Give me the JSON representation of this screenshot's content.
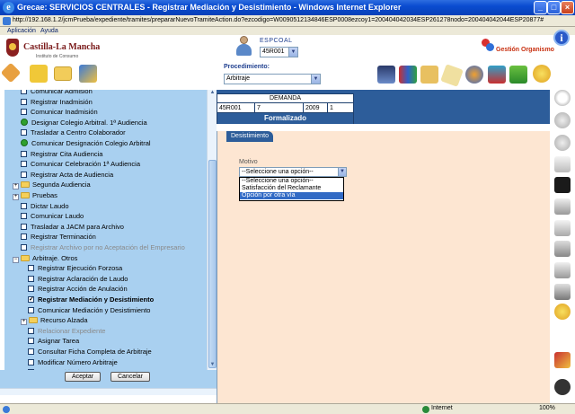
{
  "window": {
    "title": "Grecae: SERVICIOS CENTRALES - Registrar Mediación y Desistimiento - Windows Internet Explorer",
    "url": "http://192.168.1.2/jcmPrueba/expediente/tramites/prepararNuevoTramiteAction.do?ezcodigo=W0090512134846ESP0008ezcoy1=200404042034ESP261278nodo=200404042044ESP20877#",
    "menu": [
      "Aplicación",
      "Ayuda"
    ]
  },
  "header": {
    "logo_name": "Castilla-La Mancha",
    "logo_sub": "Instituto de Consumo",
    "user_name": "ESPCOAL",
    "user_code": "45R001",
    "management_label": "Gestión Organismo",
    "procedure_label": "Procedimiento:",
    "procedure_value": "Arbitraje"
  },
  "tree": {
    "items": [
      {
        "label": "Comunicar Admisión",
        "kind": "checkbox"
      },
      {
        "label": "Registrar Inadmisión",
        "kind": "checkbox"
      },
      {
        "label": "Comunicar Inadmisión",
        "kind": "checkbox"
      },
      {
        "label": "Designar Colegio Arbitral. 1ª Audiencia",
        "kind": "green"
      },
      {
        "label": "Trasladar a Centro Colaborador",
        "kind": "checkbox"
      },
      {
        "label": "Comunicar Designación Colegio Arbitral",
        "kind": "green"
      },
      {
        "label": "Registrar Cita Audiencia",
        "kind": "checkbox"
      },
      {
        "label": "Comunicar Celebración 1ª Audiencia",
        "kind": "checkbox"
      },
      {
        "label": "Registrar Acta de Audiencia",
        "kind": "checkbox"
      },
      {
        "label": "Segunda Audiencia",
        "kind": "folder"
      },
      {
        "label": "Pruebas",
        "kind": "folder"
      },
      {
        "label": "Dictar Laudo",
        "kind": "checkbox"
      },
      {
        "label": "Comunicar Laudo",
        "kind": "checkbox"
      },
      {
        "label": "Trasladar a JACM para Archivo",
        "kind": "checkbox"
      },
      {
        "label": "Registrar Terminación",
        "kind": "checkbox"
      },
      {
        "label": "Registrar Archivo por no Aceptación del Empresario",
        "kind": "checkbox-disabled"
      },
      {
        "label": "Arbitraje. Otros",
        "kind": "folder-open"
      },
      {
        "label": "Registrar Ejecución Forzosa",
        "kind": "checkbox"
      },
      {
        "label": "Registrar Aclaración de Laudo",
        "kind": "checkbox"
      },
      {
        "label": "Registrar Acción de Anulación",
        "kind": "checkbox"
      },
      {
        "label": "Registrar Mediación y Desistimiento",
        "kind": "checked"
      },
      {
        "label": "Comunicar Mediación y Desistimiento",
        "kind": "checkbox"
      },
      {
        "label": "Recurso Alzada",
        "kind": "folder"
      },
      {
        "label": "Relacionar Expediente",
        "kind": "checkbox-disabled"
      },
      {
        "label": "Asignar Tarea",
        "kind": "checkbox"
      },
      {
        "label": "Consultar Ficha Completa de Arbitraje",
        "kind": "checkbox"
      },
      {
        "label": "Modificar Número Arbitraje",
        "kind": "checkbox"
      },
      {
        "label": "Borrar Arbitraje",
        "kind": "checkbox-disabled"
      }
    ],
    "accept_label": "Aceptar",
    "cancel_label": "Cancelar"
  },
  "demand": {
    "header": "DEMANDA",
    "cells": [
      "45R001",
      "7",
      "2009",
      "1"
    ],
    "status": "Formalizado"
  },
  "form": {
    "tab_label": "Desistimiento",
    "motivo_label": "Motivo",
    "motivo_selected": "--Seleccione una opción--",
    "motivo_options": [
      "--Seleccione una opción--",
      "Satisfacción del Reclamante",
      "Opción por otra vía"
    ],
    "motivo_highlighted_index": 2
  },
  "statusbar": {
    "zone": "Internet",
    "zoom": "100%"
  },
  "colors": {
    "title_bar": "#0a4cd0",
    "tree_bg": "#a9d0f0",
    "panel_blue": "#2d5d9a",
    "form_bg": "#fde6d2",
    "selection": "#316ac5"
  }
}
